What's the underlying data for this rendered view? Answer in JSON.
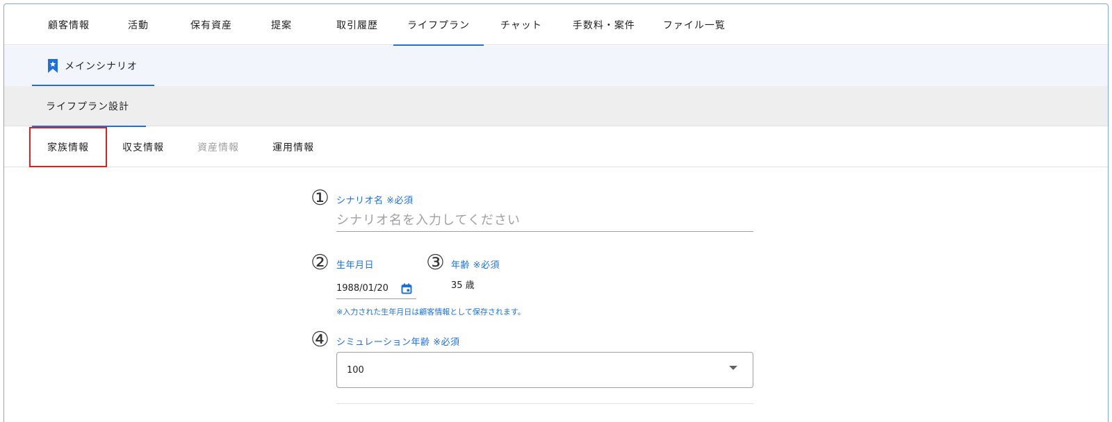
{
  "top_tabs": [
    {
      "label": "顧客情報"
    },
    {
      "label": "活動"
    },
    {
      "label": "保有資産"
    },
    {
      "label": "提案"
    },
    {
      "label": "取引履歴"
    },
    {
      "label": "ライフプラン"
    },
    {
      "label": "チャット"
    },
    {
      "label": "手数料・案件"
    },
    {
      "label": "ファイル一覧"
    }
  ],
  "active_top_tab": "ライフプラン",
  "scenario": {
    "label": "メインシナリオ",
    "icon": "bookmark-star-icon"
  },
  "design_tab": {
    "label": "ライフプラン設計"
  },
  "sub_tabs": [
    {
      "label": "家族情報",
      "state": "active"
    },
    {
      "label": "収支情報",
      "state": "enabled"
    },
    {
      "label": "資産情報",
      "state": "disabled"
    },
    {
      "label": "運用情報",
      "state": "enabled"
    }
  ],
  "form": {
    "scenario_name": {
      "marker": "①",
      "label": "シナリオ名 ※必須",
      "placeholder": "シナリオ名を入力してください",
      "value": ""
    },
    "birth_date": {
      "marker": "②",
      "label": "生年月日",
      "value": "1988/01/20",
      "hint": "※入力された生年月日は顧客情報として保存されます。"
    },
    "age": {
      "marker": "③",
      "label": "年齢 ※必須",
      "value": "35 歳"
    },
    "simulation_age": {
      "marker": "④",
      "label": "シミュレーション年齢 ※必須",
      "value": "100"
    }
  },
  "colors": {
    "accent": "#1e6fd9",
    "highlight": "#e02020",
    "scenario_band": "#f2f6fc",
    "design_band": "#eeeeee"
  }
}
